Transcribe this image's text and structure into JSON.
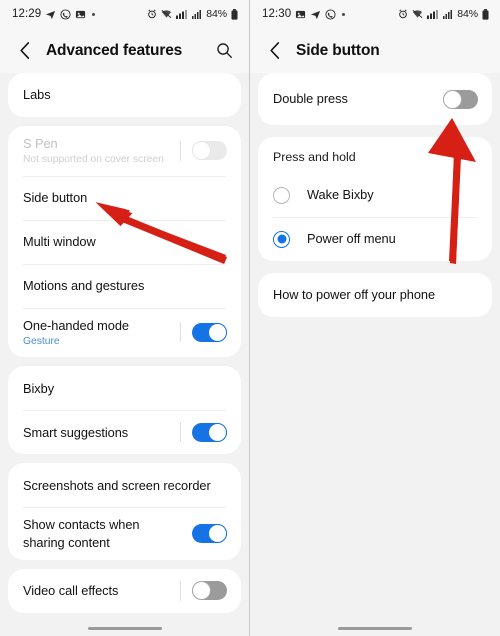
{
  "left_panel": {
    "status_bar": {
      "time": "12:29",
      "icons": [
        "telegram-icon",
        "whatsapp-icon",
        "gallery-icon",
        "dot-indicator"
      ],
      "right_icons": [
        "alarm-icon",
        "wifi-icon",
        "network-icon",
        "signal-icon"
      ],
      "battery": "84%"
    },
    "app_bar": {
      "back_label": "back-arrow",
      "title": "Advanced features",
      "search_label": "search"
    },
    "sections": [
      {
        "name": "labs-section",
        "rows": [
          {
            "title": "Labs",
            "subtitle": "",
            "control": "none",
            "disabled": false
          }
        ]
      },
      {
        "name": "pen-and-buttons-section",
        "rows": [
          {
            "title": "S Pen",
            "subtitle": "Not supported on cover screen",
            "control": "toggle-off-faded",
            "disabled": true
          },
          {
            "title": "Side button",
            "subtitle": "",
            "control": "none",
            "disabled": false
          },
          {
            "title": "Multi window",
            "subtitle": "",
            "control": "none",
            "disabled": false
          },
          {
            "title": "Motions and gestures",
            "subtitle": "",
            "control": "none",
            "disabled": false
          },
          {
            "title": "One-handed mode",
            "subtitle": "Gesture",
            "control": "toggle-on",
            "disabled": false
          }
        ]
      },
      {
        "name": "bixby-section",
        "rows": [
          {
            "title": "Bixby",
            "subtitle": "",
            "control": "none",
            "disabled": false
          },
          {
            "title": "Smart suggestions",
            "subtitle": "",
            "control": "toggle-on",
            "disabled": false
          }
        ]
      },
      {
        "name": "screenshots-section",
        "rows": [
          {
            "title": "Screenshots and screen recorder",
            "subtitle": "",
            "control": "none",
            "disabled": false
          },
          {
            "title": "Show contacts when sharing content",
            "subtitle": "",
            "control": "toggle-on",
            "disabled": false
          }
        ]
      },
      {
        "name": "video-section",
        "rows": [
          {
            "title": "Video call effects",
            "subtitle": "",
            "control": "toggle-off",
            "disabled": false
          }
        ]
      }
    ]
  },
  "right_panel": {
    "status_bar": {
      "time": "12:30",
      "icons": [
        "gallery-icon",
        "telegram-icon",
        "whatsapp-icon",
        "dot-indicator"
      ],
      "right_icons": [
        "alarm-icon",
        "wifi-icon",
        "network-icon",
        "signal-icon"
      ],
      "battery": "84%"
    },
    "app_bar": {
      "back_label": "back-arrow",
      "title": "Side button"
    },
    "double_press": {
      "title": "Double press",
      "control": "toggle-off"
    },
    "press_and_hold": {
      "heading": "Press and hold",
      "options": [
        {
          "label": "Wake Bixby",
          "selected": false
        },
        {
          "label": "Power off menu",
          "selected": true
        }
      ]
    },
    "help": {
      "title": "How to power off your phone"
    }
  },
  "annotations": {
    "arrow_color": "#d61f15",
    "left_arrow_target": "Side button",
    "right_arrow_target": "Double press toggle"
  }
}
